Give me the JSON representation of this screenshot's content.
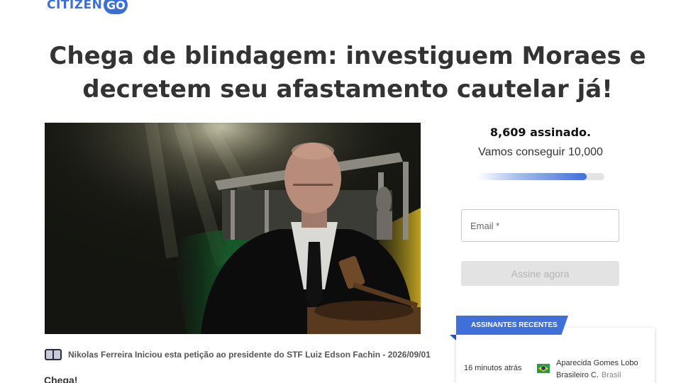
{
  "header": {
    "logo_text": "CITIZEN",
    "logo_badge": "GO"
  },
  "petition": {
    "title": "Chega de blindagem: investiguem Moraes e decretem seu afastamento cautelar já!",
    "author_line": "Nikolas Ferreira Iniciou esta petição ao presidente do STF Luiz Edson Fachin - 2026/09/01",
    "intro": "Chega!"
  },
  "signing": {
    "count_text": "8,609 assinado.",
    "goal_text": "Vamos conseguir 10,000",
    "progress_fraction": 0.86,
    "email_placeholder": "Email *",
    "submit_label": "Assine agora"
  },
  "recent": {
    "heading": "ASSINANTES RECENTES",
    "items": [
      {
        "time": "16 minutos atrás",
        "name": "Aparecida Gomes Lobo",
        "name2": "Brasileiro C.",
        "country": "Brasil",
        "flag": "brazil-flag"
      }
    ]
  },
  "colors": {
    "brand": "#3f6fd8",
    "button_disabled": "#e3e3e3",
    "title": "#333333"
  }
}
